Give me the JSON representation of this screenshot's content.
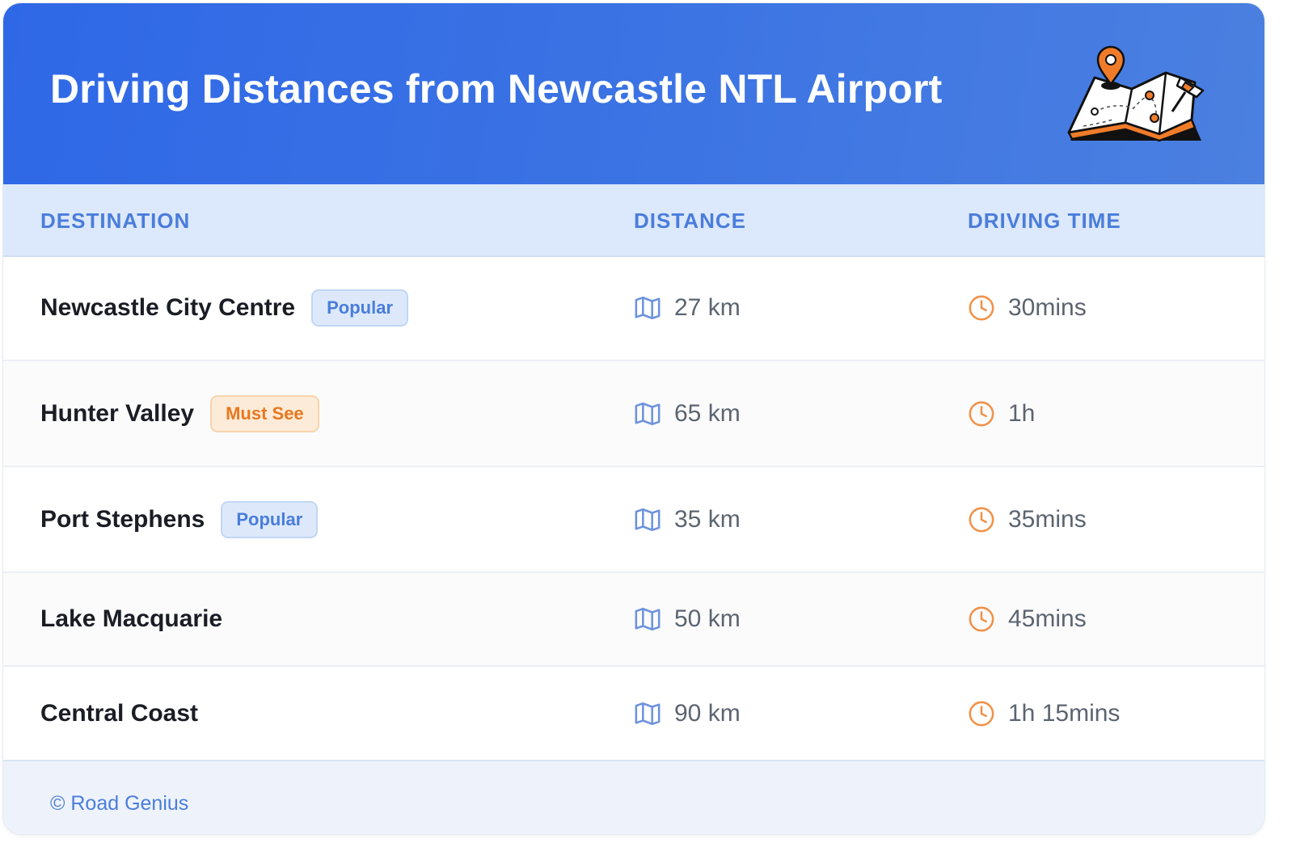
{
  "header": {
    "title": "Driving Distances from Newcastle NTL Airport",
    "illustration_icon": "map-with-pins-icon"
  },
  "table": {
    "columns": [
      "DESTINATION",
      "DISTANCE",
      "DRIVING TIME"
    ],
    "rows": [
      {
        "destination": "Newcastle City Centre",
        "badge": "Popular",
        "badge_type": "popular",
        "distance": "27 km",
        "time": "30mins"
      },
      {
        "destination": "Hunter Valley",
        "badge": "Must See",
        "badge_type": "mustsee",
        "distance": "65 km",
        "time": "1h"
      },
      {
        "destination": "Port Stephens",
        "badge": "Popular",
        "badge_type": "popular",
        "distance": "35 km",
        "time": "35mins"
      },
      {
        "destination": "Lake Macquarie",
        "badge": "",
        "badge_type": "",
        "distance": "50 km",
        "time": "45mins"
      },
      {
        "destination": "Central Coast",
        "badge": "",
        "badge_type": "",
        "distance": "90 km",
        "time": "1h 15mins"
      }
    ],
    "distance_icon": "map-icon",
    "time_icon": "clock-icon"
  },
  "footer": {
    "text": "© Road Genius"
  },
  "colors": {
    "header_blue": "#2f68e6",
    "accent_blue": "#4a7ddb",
    "accent_orange": "#e8781e",
    "table_header_bg": "#dce8fb"
  }
}
